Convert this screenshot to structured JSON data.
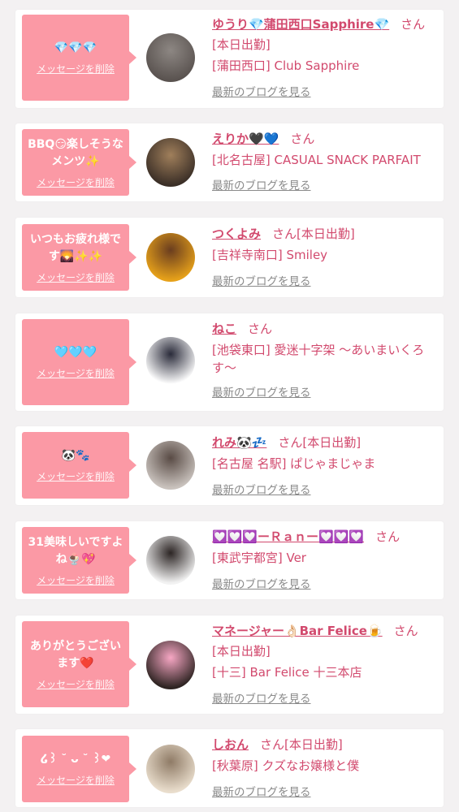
{
  "cards": [
    {
      "message": "💎💎💎",
      "delete_label": "メッセージを削除",
      "name": "ゆうり💎蒲田西口Sapphire💎",
      "san": "さん",
      "line2": "[本日出勤]",
      "line3": "[蒲田西口] Club Sapphire",
      "blog": "最新のブログを見る",
      "avatar_colors": [
        "#5a5350",
        "#8d8783"
      ]
    },
    {
      "message": "BBQ😏楽しそうなメンツ✨",
      "delete_label": "メッセージを削除",
      "name": "えりか🖤💙",
      "san": "さん",
      "line2": "[北名古屋] CASUAL SNACK PARFAIT",
      "line3": "",
      "blog": "最新のブログを見る",
      "avatar_colors": [
        "#3b2f27",
        "#a07f5b"
      ]
    },
    {
      "message": "いつもお疲れ様です🌄✨✨",
      "delete_label": "メッセージを削除",
      "name": "つくよみ",
      "san": "さん[本日出勤]",
      "line2": "[吉祥寺南口] Smiley",
      "line3": "",
      "blog": "最新のブログを見る",
      "avatar_colors": [
        "#e6a11a",
        "#6a3d1f"
      ]
    },
    {
      "message": "🩵🩵🩵",
      "delete_label": "メッセージを削除",
      "name": "ねこ",
      "san": "さん",
      "line2": "[池袋東口] 愛迷十字架 〜あいまいくろす〜",
      "line3": "",
      "blog": "最新のブログを見る",
      "avatar_colors": [
        "#ffffff",
        "#2a2b3a"
      ]
    },
    {
      "message": "🐼🐾",
      "delete_label": "メッセージを削除",
      "name": "れみ🐼💤",
      "san": "さん[本日出勤]",
      "line2": "[名古屋 名駅] ぱじゃまじゃま",
      "line3": "",
      "blog": "最新のブログを見る",
      "avatar_colors": [
        "#c9c2bd",
        "#594b45"
      ]
    },
    {
      "message": "31美味しいですよね🍨💖",
      "delete_label": "メッセージを削除",
      "name": "💟💟💟ーＲａｎー💟💟💟",
      "san": "さん",
      "line2": "[東武宇都宮] Ver",
      "line3": "",
      "blog": "最新のブログを見る",
      "avatar_colors": [
        "#f2f2f2",
        "#2c2524"
      ]
    },
    {
      "message": "ありがとうございます❤️",
      "delete_label": "メッセージを削除",
      "name": "マネージャー👌🏻Bar Felice🍺",
      "san": "さん",
      "line2": "[本日出勤]",
      "line3": "[十三] Bar Felice 十三本店",
      "blog": "最新のブログを見る",
      "avatar_colors": [
        "#2e2422",
        "#f7a7c4"
      ]
    },
    {
      "message": "໒꒱ ˘ ᴗ ˘ ꒱❤",
      "delete_label": "メッセージを削除",
      "name": "しおん",
      "san": "さん[本日出勤]",
      "line2": "[秋葉原] クズなお嬢様と僕",
      "line3": "",
      "blog": "最新のブログを見る",
      "avatar_colors": [
        "#e9ddcc",
        "#8f7b66"
      ]
    }
  ]
}
